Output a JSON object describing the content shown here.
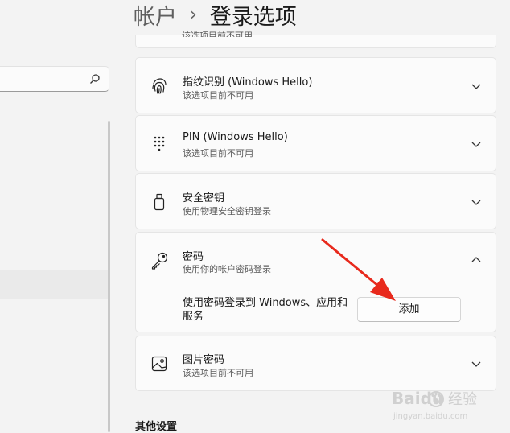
{
  "breadcrumb": {
    "account": "帐户",
    "separator": "›",
    "page": "登录选项"
  },
  "search": {
    "icon": "search-icon"
  },
  "top_partial": {
    "subtitle": "该选项目前不可用"
  },
  "cards": [
    {
      "id": "fingerprint",
      "title": "指纹识别 (Windows Hello)",
      "subtitle": "该选项目前不可用",
      "icon": "fingerprint-icon"
    },
    {
      "id": "pin",
      "title": "PIN (Windows Hello)",
      "subtitle": "该选项目前不可用",
      "icon": "pin-keypad-icon"
    },
    {
      "id": "security-key",
      "title": "安全密钥",
      "subtitle": "使用物理安全密钥登录",
      "icon": "usb-key-icon"
    },
    {
      "id": "password",
      "title": "密码",
      "subtitle": "使用你的帐户密码登录",
      "icon": "key-icon",
      "expanded": true
    },
    {
      "id": "picture-password",
      "title": "图片密码",
      "subtitle": "该选项目前不可用",
      "icon": "picture-icon"
    }
  ],
  "password_panel": {
    "description": "使用密码登录到 Windows、应用和服务",
    "add_label": "添加"
  },
  "other_settings": {
    "heading": "其他设置"
  },
  "watermark": {
    "brand": "Baidu",
    "text_cn": "经验",
    "url": "jingyan.baidu.com"
  },
  "colors": {
    "background": "#f3f3f3",
    "card": "#fbfbfb",
    "annotation_arrow": "#e8291c"
  }
}
